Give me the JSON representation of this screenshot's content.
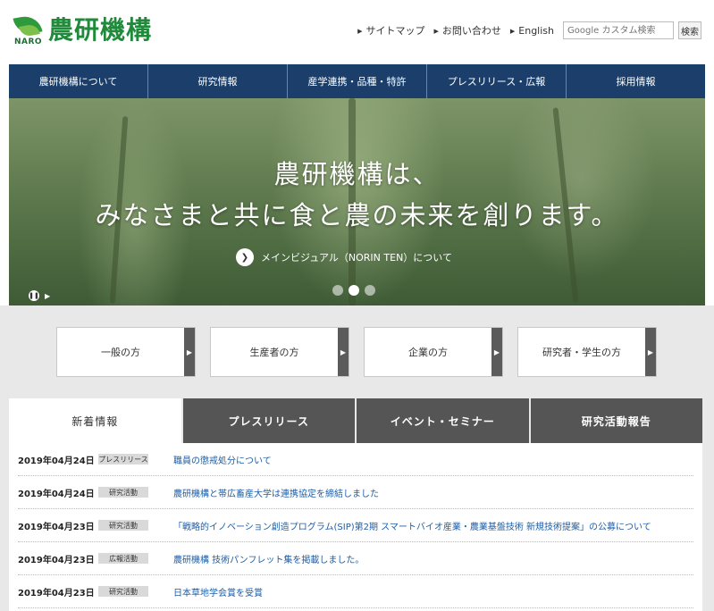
{
  "header": {
    "logo_mark": "NARO",
    "logo_text": "農研機構",
    "links": [
      "サイトマップ",
      "お問い合わせ",
      "English"
    ],
    "search_placeholder": "Google カスタム検索",
    "search_button": "検索"
  },
  "nav": {
    "items": [
      "農研機構について",
      "研究情報",
      "産学連携・品種・特許",
      "プレスリリース・広報",
      "採用情報"
    ]
  },
  "hero": {
    "title_line1": "農研機構は、",
    "title_line2": "みなさまと共に食と農の未来を創ります。",
    "link_text": "メインビジュアル（NORIN TEN）について",
    "active_slide": 2,
    "slide_count": 3
  },
  "audience": [
    "一般の方",
    "生産者の方",
    "企業の方",
    "研究者・学生の方"
  ],
  "tabs": {
    "items": [
      "新着情報",
      "プレスリリース",
      "イベント・セミナー",
      "研究活動報告"
    ],
    "active_index": 0
  },
  "news": [
    {
      "date": "2019年04月24日",
      "category": "プレスリリース",
      "title": "職員の懲戒処分について"
    },
    {
      "date": "2019年04月24日",
      "category": "研究活動",
      "title": "農研機構と帯広畜産大学は連携協定を締結しました"
    },
    {
      "date": "2019年04月23日",
      "category": "研究活動",
      "title": "「戦略的イノベーション創造プログラム(SIP)第2期 スマートバイオ産業・農業基盤技術 新規技術提案」の公募について"
    },
    {
      "date": "2019年04月23日",
      "category": "広報活動",
      "title": "農研機構 技術パンフレット集を掲載しました。"
    },
    {
      "date": "2019年04月23日",
      "category": "研究活動",
      "title": "日本草地学会賞を受賞"
    }
  ],
  "colors": {
    "nav_bg": "#1b3f6a",
    "brand_green": "#1e8a3a",
    "link_blue": "#1d5ea8"
  }
}
